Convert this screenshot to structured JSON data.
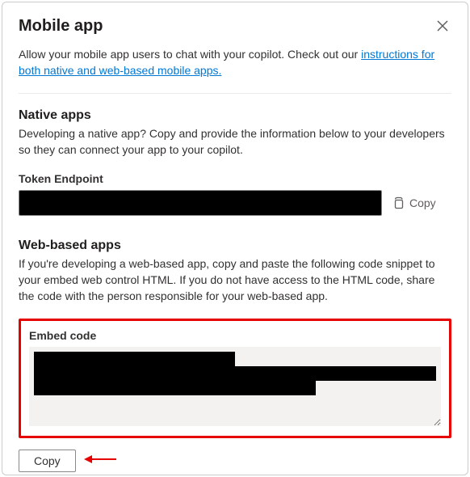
{
  "header": {
    "title": "Mobile app"
  },
  "intro": {
    "text_before": "Allow your mobile app users to chat with your copilot. Check out our ",
    "link_text": "instructions for both native and web-based mobile apps."
  },
  "native": {
    "heading": "Native apps",
    "description": "Developing a native app? Copy and provide the information below to your developers so they can connect your app to your copilot.",
    "token_label": "Token Endpoint",
    "copy_label": "Copy"
  },
  "web": {
    "heading": "Web-based apps",
    "description": "If you're developing a web-based app, copy and paste the following code snippet to your embed web control HTML. If you do not have access to the HTML code, share the code with the person responsible for your web-based app.",
    "embed_label": "Embed code",
    "copy_button": "Copy"
  }
}
